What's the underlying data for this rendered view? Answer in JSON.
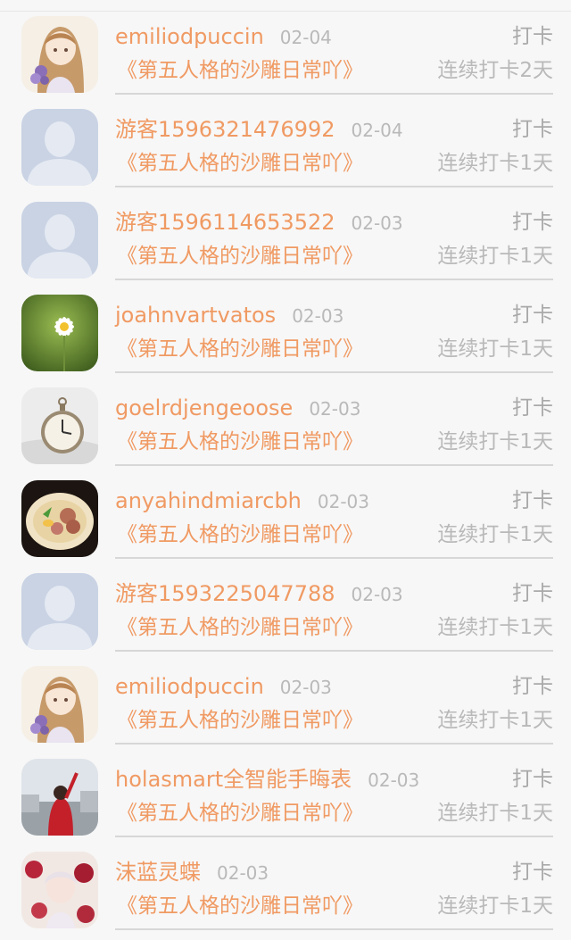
{
  "list": {
    "items": [
      {
        "user": "emiliodpuccin",
        "date": "02-04",
        "action": "打卡",
        "title": "《第五人格的沙雕日常吖》",
        "streak": "连续打卡2天",
        "avatar": "anime-girl-avatar-icon"
      },
      {
        "user": "游客1596321476992",
        "date": "02-04",
        "action": "打卡",
        "title": "《第五人格的沙雕日常吖》",
        "streak": "连续打卡1天",
        "avatar": "default-user-avatar-icon"
      },
      {
        "user": "游客1596114653522",
        "date": "02-03",
        "action": "打卡",
        "title": "《第五人格的沙雕日常吖》",
        "streak": "连续打卡1天",
        "avatar": "default-user-avatar-icon"
      },
      {
        "user": "joahnvartvatos",
        "date": "02-03",
        "action": "打卡",
        "title": "《第五人格的沙雕日常吖》",
        "streak": "连续打卡1天",
        "avatar": "daisy-flower-avatar-icon"
      },
      {
        "user": "goelrdjengeoose",
        "date": "02-03",
        "action": "打卡",
        "title": "《第五人格的沙雕日常吖》",
        "streak": "连续打卡1天",
        "avatar": "pocket-watch-avatar-icon"
      },
      {
        "user": "anyahindmiarcbh",
        "date": "02-03",
        "action": "打卡",
        "title": "《第五人格的沙雕日常吖》",
        "streak": "连续打卡1天",
        "avatar": "ramen-bowl-avatar-icon"
      },
      {
        "user": "游客1593225047788",
        "date": "02-03",
        "action": "打卡",
        "title": "《第五人格的沙雕日常吖》",
        "streak": "连续打卡1天",
        "avatar": "default-user-avatar-icon"
      },
      {
        "user": "emiliodpuccin",
        "date": "02-03",
        "action": "打卡",
        "title": "《第五人格的沙雕日常吖》",
        "streak": "连续打卡1天",
        "avatar": "anime-girl-avatar-icon"
      },
      {
        "user": "holasmart全智能手晦表",
        "date": "02-03",
        "action": "打卡",
        "title": "《第五人格的沙雕日常吖》",
        "streak": "连续打卡1天",
        "avatar": "red-dress-girl-avatar-icon"
      },
      {
        "user": "沫蓝灵蝶",
        "date": "02-03",
        "action": "打卡",
        "title": "《第五人格的沙雕日常吖》",
        "streak": "连续打卡1天",
        "avatar": "anime-flowers-avatar-icon"
      }
    ]
  }
}
